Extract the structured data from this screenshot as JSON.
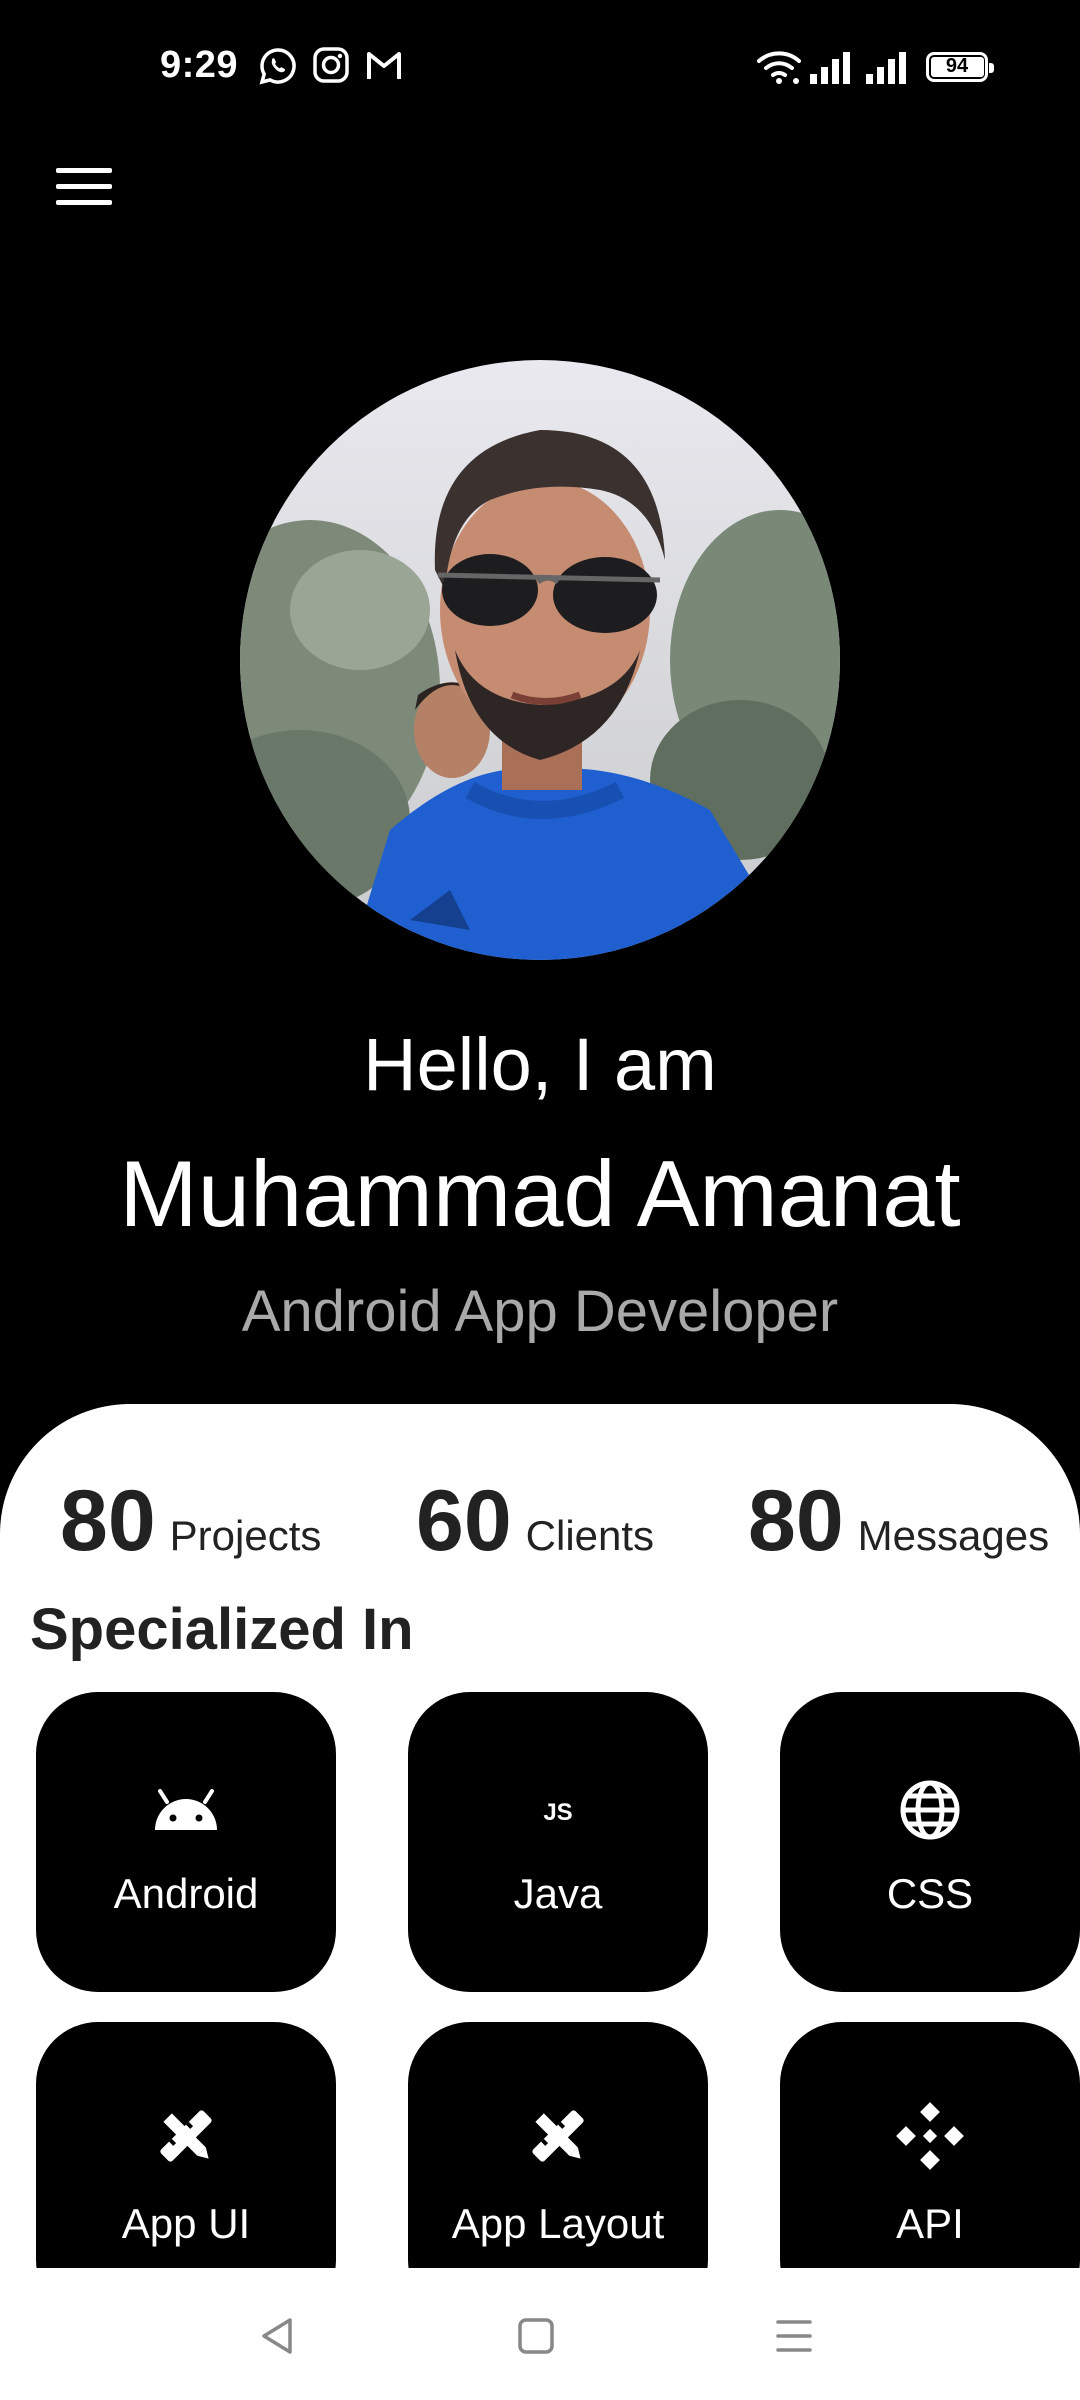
{
  "status_bar": {
    "time": "9:29",
    "notification_icons": [
      "whatsapp-icon",
      "instagram-icon",
      "gmail-icon"
    ],
    "battery": 94
  },
  "header": {
    "menu_icon": "hamburger-menu-icon"
  },
  "profile": {
    "greeting": "Hello, I am",
    "name": "Muhammad Amanat",
    "role": "Android App Developer"
  },
  "stats": [
    {
      "value": "80",
      "label": "Projects"
    },
    {
      "value": "60",
      "label": "Clients"
    },
    {
      "value": "80",
      "label": "Messages"
    }
  ],
  "specialized": {
    "title": "Specialized In",
    "items": [
      {
        "label": "Android",
        "icon": "android-icon"
      },
      {
        "label": "Java",
        "icon": "js-icon"
      },
      {
        "label": "CSS",
        "icon": "globe-icon"
      },
      {
        "label": "App UI",
        "icon": "design-tools-icon"
      },
      {
        "label": "App Layout",
        "icon": "design-tools-icon"
      },
      {
        "label": "API",
        "icon": "api-icon"
      }
    ]
  },
  "nav_bar": [
    "back-icon",
    "home-icon",
    "recents-icon"
  ],
  "colors": {
    "background": "#000000",
    "sheet": "#ffffff",
    "role_text": "#a9a9a9"
  }
}
